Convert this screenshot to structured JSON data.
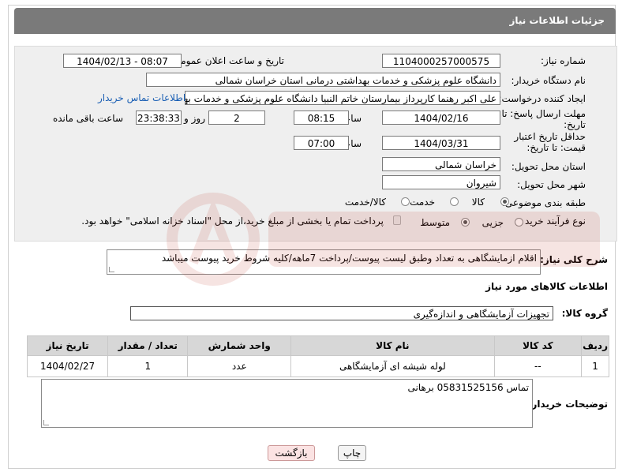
{
  "title": "جزئیات اطلاعات نیاز",
  "fields": {
    "need_number_label": "شماره نیاز:",
    "need_number": "1104000257000575",
    "announce_label": "تاریخ و ساعت اعلان عمومی:",
    "announce_value": "1404/02/13 - 08:07",
    "buyer_org_label": "نام دستگاه خریدار:",
    "buyer_org": "دانشگاه علوم پزشکی و خدمات بهداشتی درمانی استان خراسان شمالی",
    "creator_label": "ایجاد کننده درخواست:",
    "creator": "علی اکبر رهنما کارپرداز بیمارستان خاتم النبیا دانشگاه علوم پزشکی و خدمات بهداشتی",
    "contact_link": "اطلاعات تماس خریدار",
    "deadline_label": "مهلت ارسال پاسخ: تا تاریخ:",
    "deadline_date": "1404/02/16",
    "time_label": "ساعت",
    "deadline_time": "08:15",
    "days_value": "2",
    "days_label": "روز و",
    "remaining_time": "23:38:33",
    "remaining_label": "ساعت باقی مانده",
    "price_validity_label": "حداقل تاریخ اعتبار قیمت: تا تاریخ:",
    "price_validity_date": "1404/03/31",
    "price_validity_time": "07:00",
    "province_label": "استان محل تحویل:",
    "province": "خراسان شمالی",
    "city_label": "شهر محل تحویل:",
    "city": "شیروان",
    "category_label": "طبقه بندی موضوعی:",
    "category_options": [
      "کالا",
      "خدمت",
      "کالا/خدمت"
    ],
    "process_label": "نوع فرآیند خرید :",
    "process_options": [
      "جزیی",
      "متوسط"
    ],
    "payment_note": "پرداخت تمام یا بخشی از مبلغ خرید،از محل \"اسناد خزانه اسلامی\" خواهد بود."
  },
  "description": {
    "label": "شرح کلی نیاز:",
    "text": "اقلام ازمایشگاهی به تعداد وطبق لیست پیوست/پرداخت 7ماهه/کلیه شروط خرید پیوست میباشد"
  },
  "goods_section": {
    "title": "اطلاعات کالاهای مورد نیاز",
    "group_label": "گروه کالا:",
    "group_value": "تجهیزات آزمایشگاهی و اندازه‌گیری"
  },
  "table": {
    "headers": [
      "ردیف",
      "کد کالا",
      "نام کالا",
      "واحد شمارش",
      "تعداد / مقدار",
      "تاریخ نیاز"
    ],
    "rows": [
      [
        "1",
        "--",
        "لوله شیشه ای آزمایشگاهی",
        "عدد",
        "1",
        "1404/02/27"
      ]
    ]
  },
  "buyer_notes": {
    "label": "توضیحات خریدار:",
    "text": "تماس 05831525156 برهانی"
  },
  "buttons": {
    "print": "چاپ",
    "back": "بازگشت"
  },
  "colors": {
    "titlebar": "#7a7a7a",
    "link": "#1a5fb4",
    "watermark": "#c0392b"
  }
}
